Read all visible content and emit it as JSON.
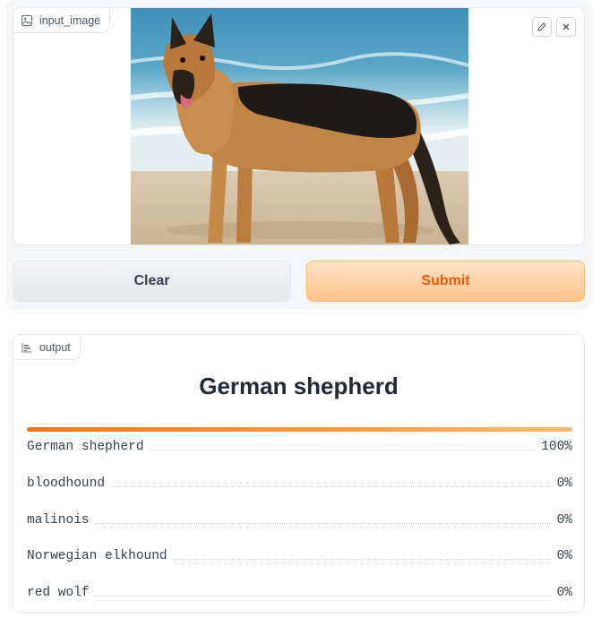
{
  "input": {
    "label": "input_image",
    "label_icon": "image-icon",
    "edit_icon": "pencil-icon",
    "close_icon": "close-icon"
  },
  "buttons": {
    "clear": "Clear",
    "submit": "Submit"
  },
  "output": {
    "label": "output",
    "label_icon": "bar-chart-icon",
    "top_label": "German shepherd",
    "confidence_bar_fraction": 1.0,
    "confidences": [
      {
        "label": "German shepherd",
        "value": "100%"
      },
      {
        "label": "bloodhound",
        "value": "0%"
      },
      {
        "label": "malinois",
        "value": "0%"
      },
      {
        "label": "Norwegian elkhound",
        "value": "0%"
      },
      {
        "label": "red wolf",
        "value": "0%"
      }
    ]
  },
  "colors": {
    "accent": "#f97316",
    "submit_text": "#ea580c"
  }
}
